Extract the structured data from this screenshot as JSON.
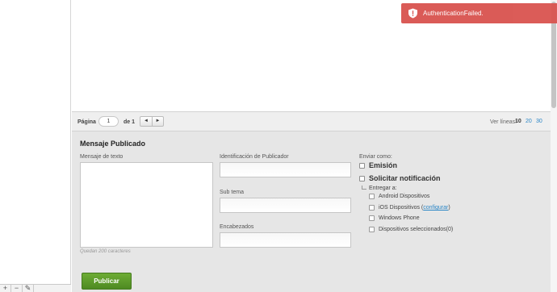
{
  "pager": {
    "page_label": "Página",
    "page_value": "1",
    "of_label": "de 1",
    "prev_glyph": "◄",
    "next_glyph": "►",
    "lines_label": "Ver líneas:",
    "line_options": [
      "10",
      "20",
      "30"
    ],
    "current_lines": "10"
  },
  "form": {
    "title": "Mensaje Publicado",
    "message_label": "Mensaje de texto",
    "chars_left": "Quedan 200 caracteres",
    "publisher_label": "Identificación de Publicador",
    "subtopic_label": "Sub tema",
    "headers_label": "Encabezados",
    "send_as_label": "Enviar como:",
    "broadcast_label": "Emisión",
    "request_notification_label": "Solicitar notificación",
    "deliver_to_label": "Entregar a:",
    "android_label": "Android Dispositivos",
    "ios_label": "iOS Dispositivos (",
    "ios_configure_link": "configurar",
    "ios_label_end": ")",
    "windows_phone_label": "Windows Phone",
    "selected_devices_label": "Dispositivos seleccionados(0)",
    "publish_button": "Publicar"
  },
  "toast": {
    "message": "AuthenticationFailed.",
    "color": "#d9534f",
    "icon": "warning-shield-icon"
  },
  "sidebar_tools": [
    "+",
    "−",
    "✎"
  ]
}
